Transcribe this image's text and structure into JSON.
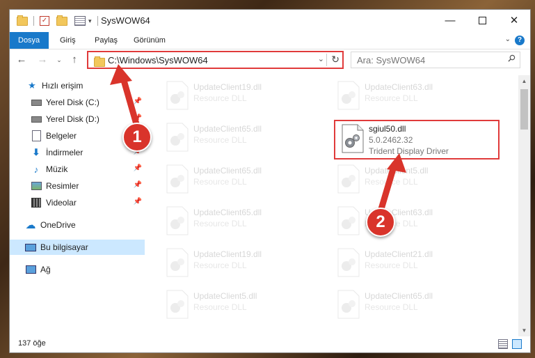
{
  "window": {
    "title": "SysWOW64",
    "minimize_icon": "minimize-icon",
    "maximize_icon": "maximize-icon",
    "close_icon": "close-icon"
  },
  "ribbon": {
    "tabs": [
      {
        "label": "Dosya",
        "active": true
      },
      {
        "label": "Giriş",
        "active": false
      },
      {
        "label": "Paylaş",
        "active": false
      },
      {
        "label": "Görünüm",
        "active": false
      }
    ]
  },
  "address": {
    "path": "C:\\Windows\\SysWOW64",
    "search_placeholder": "Ara: SysWOW64"
  },
  "nav": {
    "items": [
      {
        "label": "Hızlı erişim",
        "icon": "star-icon",
        "pinned": false
      },
      {
        "label": "Yerel Disk (C:)",
        "icon": "drive-icon",
        "pinned": true
      },
      {
        "label": "Yerel Disk (D:)",
        "icon": "drive-icon",
        "pinned": true
      },
      {
        "label": "Belgeler",
        "icon": "documents-icon",
        "pinned": true
      },
      {
        "label": "İndirmeler",
        "icon": "download-icon",
        "pinned": true
      },
      {
        "label": "Müzik",
        "icon": "music-icon",
        "pinned": true
      },
      {
        "label": "Resimler",
        "icon": "pictures-icon",
        "pinned": true
      },
      {
        "label": "Videolar",
        "icon": "videos-icon",
        "pinned": true
      },
      {
        "label": "OneDrive",
        "icon": "cloud-icon",
        "pinned": false
      },
      {
        "label": "Bu bilgisayar",
        "icon": "computer-icon",
        "pinned": false
      },
      {
        "label": "Ağ",
        "icon": "network-icon",
        "pinned": false
      }
    ]
  },
  "files": {
    "left": [
      {
        "name": "UpdateClient19.dll",
        "desc": "Resource DLL"
      },
      {
        "name": "UpdateClient65.dll",
        "desc": "Resource DLL"
      },
      {
        "name": "UpdateClient65.dll",
        "desc": "Resource DLL"
      },
      {
        "name": "UpdateClient65.dll",
        "desc": "Resource DLL"
      },
      {
        "name": "UpdateClient19.dll",
        "desc": "Resource DLL"
      },
      {
        "name": "UpdateClient5.dll",
        "desc": "Resource DLL"
      }
    ],
    "right": [
      {
        "name": "UpdateClient63.dll",
        "desc": "Resource DLL"
      },
      {
        "name": "UpdateClient5.dll",
        "desc": "Resource DLL"
      },
      {
        "name": "UpdateClient63.dll",
        "desc": "Resource DLL"
      },
      {
        "name": "UpdateClient21.dll",
        "desc": "Resource DLL"
      },
      {
        "name": "UpdateClient65.dll",
        "desc": "Resource DLL"
      }
    ],
    "highlighted": {
      "name": "sgiul50.dll",
      "version": "5.0.2462.32",
      "desc": "Trident Display Driver"
    }
  },
  "status": {
    "count": "137 öğe"
  },
  "annotations": {
    "step1": "1",
    "step2": "2",
    "color": "#d9342b"
  }
}
